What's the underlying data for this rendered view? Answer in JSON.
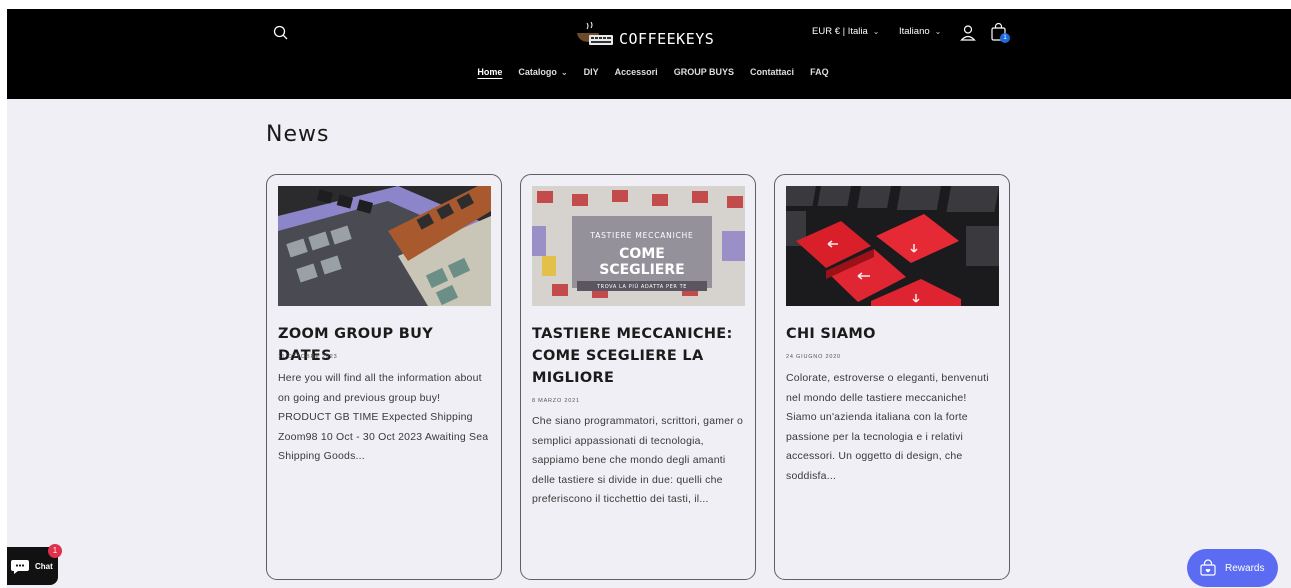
{
  "header": {
    "logo_text": "COFFEEKEYS",
    "currency_label": "EUR € | Italia",
    "language_label": "Italiano",
    "cart_count": "1"
  },
  "nav": {
    "items": [
      {
        "label": "Home"
      },
      {
        "label": "Catalogo"
      },
      {
        "label": "DIY"
      },
      {
        "label": "Accessori"
      },
      {
        "label": "GROUP BUYS"
      },
      {
        "label": "Contattaci"
      },
      {
        "label": "FAQ"
      }
    ]
  },
  "page": {
    "title": "News"
  },
  "articles": [
    {
      "title": "ZOOM GROUP BUY DATES",
      "date": "11 ottobre 2023",
      "excerpt": "Here you will find all the information about on going and previous group buy!  PRODUCT  GB TIME Expected Shipping Zoom98 10 Oct - 30 Oct 2023 Awaiting Sea Shipping Goods..."
    },
    {
      "title": "TASTIERE MECCANICHE: COME SCEGLIERE LA MIGLIORE",
      "date": "8 marzo 2021",
      "image_text": {
        "line1": "TASTIERE MECCANICHE",
        "line2": "COME",
        "line3": "SCEGLIERE",
        "line4": "TROVA LA PIÙ ADATTA PER TE"
      },
      "excerpt": "Che siano programmatori, scrittori, gamer o semplici appassionati di tecnologia, sappiamo bene che mondo degli amanti delle tastiere si divide in due: quelli che preferiscono il ticchettio dei tasti, il..."
    },
    {
      "title": "CHI SIAMO",
      "date": "24 giugno 2020",
      "excerpt": "Colorate, estroverse o eleganti, benvenuti nel mondo delle tastiere meccaniche! Siamo un'azienda italiana con la forte passione per la tecnologia e i relativi accessori. Un oggetto di design, che soddisfa..."
    }
  ],
  "chat": {
    "label": "Chat",
    "badge": "1"
  },
  "rewards": {
    "label": "Rewards"
  },
  "colors": {
    "header_bg": "#000000",
    "page_bg": "#efeff5",
    "cart_badge": "#1c6ce0",
    "rewards_bg": "#5b6cf3",
    "chat_badge": "#e22f4a"
  }
}
